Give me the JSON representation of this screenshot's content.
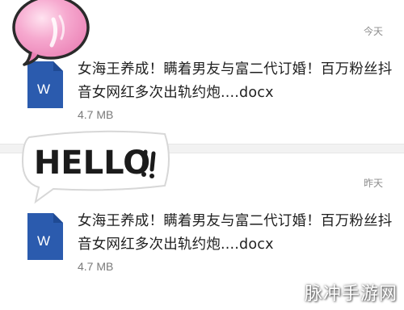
{
  "messages": [
    {
      "time": "今天",
      "file_name": "女海王养成！瞒着男友与富二代订婚！百万粉丝抖音女网红多次出轨约炮....docx",
      "file_size": "4.7 MB",
      "file_icon": "word-document-icon",
      "icon_letter": "W"
    },
    {
      "time": "昨天",
      "file_name": "女海王养成！瞒着男友与富二代订婚！百万粉丝抖音女网红多次出轨约炮....docx",
      "file_size": "4.7 MB",
      "file_icon": "word-document-icon",
      "icon_letter": "W"
    }
  ],
  "sticker": {
    "text": "HELLO"
  },
  "decoration": {
    "icon": "pink-balloon-icon"
  },
  "watermark": {
    "text": "脉冲手游网"
  },
  "colors": {
    "word_blue": "#2b5bae",
    "word_blue_dark": "#1f4a94",
    "bubble_pink": "#f6a9cf",
    "divider": "#f2f2f2",
    "meta_gray": "#8d8d8d"
  }
}
